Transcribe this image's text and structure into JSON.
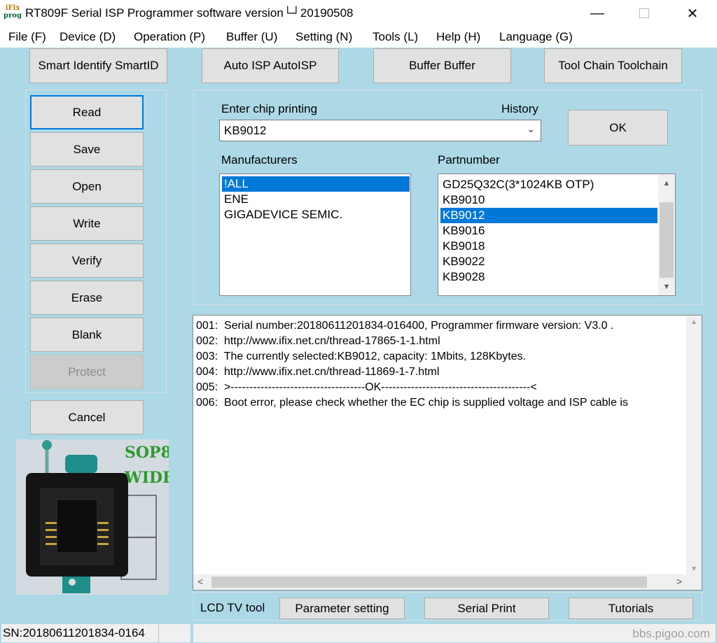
{
  "window": {
    "logo_line1": "iFix",
    "logo_line2": "prog",
    "title": "RT809F Serial ISP Programmer software version└┘20190508",
    "minimize": "—",
    "close": "✕"
  },
  "menu": {
    "file": "File (F)",
    "device": "Device (D)",
    "operation": "Operation (P)",
    "buffer": "Buffer (U)",
    "setting": "Setting (N)",
    "tools": "Tools (L)",
    "help": "Help (H)",
    "language": "Language (G)"
  },
  "toolbar": {
    "smart_identify": "Smart Identify SmartID",
    "auto_isp": "Auto ISP AutoISP",
    "buffer": "Buffer Buffer",
    "tool_chain": "Tool Chain Toolchain"
  },
  "actions": {
    "read": "Read",
    "save": "Save",
    "open": "Open",
    "write": "Write",
    "verify": "Verify",
    "erase": "Erase",
    "blank": "Blank",
    "protect": "Protect",
    "cancel": "Cancel"
  },
  "chip": {
    "enter_label": "Enter chip printing",
    "history_label": "History",
    "value": "KB9012",
    "ok": "OK",
    "manufacturers_label": "Manufacturers",
    "manufacturers": [
      "!ALL",
      "ENE",
      "GIGADEVICE SEMIC."
    ],
    "partnumber_label": "Partnumber",
    "partnumbers": [
      "GD25Q32C(3*1024KB OTP)",
      "KB9010",
      "KB9012",
      "KB9016",
      "KB9018",
      "KB9022",
      "KB9028"
    ]
  },
  "log": [
    "001:  Serial number:20180611201834-016400, Programmer firmware version: V3.0 .",
    "002:  http://www.ifix.net.cn/thread-17865-1-1.html",
    "003:  The currently selected:KB9012, capacity: 1Mbits, 128Kbytes.",
    "004:  http://www.ifix.net.cn/thread-11869-1-7.html",
    "005:  >------------------------------------OK----------------------------------------<",
    "006:  Boot error, please check whether the EC chip is supplied voltage and ISP cable is"
  ],
  "socket": {
    "line1": "SOP8",
    "line2": "WIDE"
  },
  "bottom": {
    "lcd_label": "LCD TV tool",
    "parameter": "Parameter setting",
    "serial_print": "Serial Print",
    "tutorials": "Tutorials"
  },
  "status": {
    "sn": "SN:20180611201834-0164",
    "watermark": "bbs.pigoo.com"
  }
}
